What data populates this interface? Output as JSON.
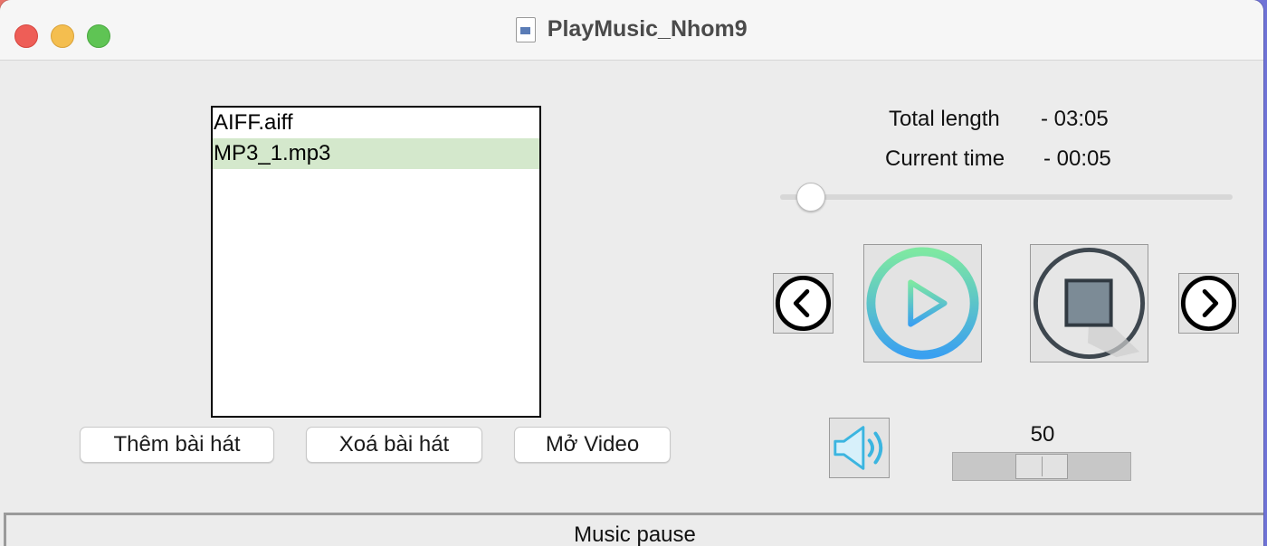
{
  "window": {
    "title": "PlayMusic_Nhom9"
  },
  "playlist": {
    "items": [
      "AIFF.aiff",
      "MP3_1.mp3"
    ],
    "selected_index": 1
  },
  "buttons": {
    "add": "Thêm bài hát",
    "delete": "Xoá bài hát",
    "open_video": "Mở Video"
  },
  "info": {
    "total_label": "Total length",
    "total_value": "- 03:05",
    "current_label": "Current time",
    "current_value": "- 00:05"
  },
  "seek": {
    "fraction": 0.065
  },
  "volume": {
    "value": "50",
    "fraction": 0.5
  },
  "status": {
    "text": "Music pause"
  },
  "icons": {
    "prev": "chevron-left-circle-icon",
    "play": "play-circle-icon",
    "stop": "stop-circle-icon",
    "next": "chevron-right-circle-icon",
    "volume": "speaker-icon"
  },
  "colors": {
    "selected_row": "#d4e8cc",
    "play_gradient_top": "#7ee8a2",
    "play_gradient_bottom": "#3aa0f0"
  }
}
